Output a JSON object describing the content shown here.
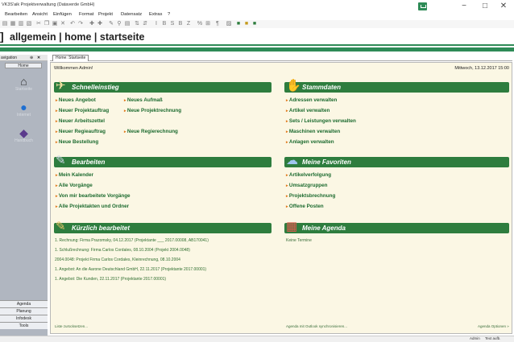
{
  "window": {
    "title": "VK3S'aik Projektverwaltung (Dataverde GmbH)",
    "controls": {
      "minimize": "−",
      "maximize": "□",
      "close": "✕"
    }
  },
  "menu": [
    "Bearbeiten",
    "Ansicht",
    "Einfügen",
    "Format",
    "Projekt",
    "Datensatz",
    "Extras",
    "?"
  ],
  "header": {
    "title": "allgemein | home | startseite"
  },
  "navigation": {
    "title": "avigation",
    "pin": "⊕",
    "close": "✕",
    "home_tab": "Home",
    "items": [
      {
        "label": "Startseite",
        "icon": "house-icon",
        "glyph": "⌂"
      },
      {
        "label": "Internet",
        "icon": "globe-icon",
        "glyph": "●"
      },
      {
        "label": "Handbuch",
        "icon": "book-icon",
        "glyph": "◆"
      }
    ],
    "bottom_tabs": [
      "Agenda",
      "Planung",
      "Infodesk",
      "Tools"
    ]
  },
  "tabs": [
    {
      "label": "Home: Startseite"
    }
  ],
  "content": {
    "welcome": "Willkommen Admin!",
    "datetime": "Mittwoch, 13.12.2017 15:00",
    "schnelleinstieg": {
      "title": "Schnelleinstieg",
      "col1": [
        "Neues Angebot",
        "Neuer Projektauftrag",
        "Neuer Arbeitszettel",
        "Neuer Regieauftrag",
        "Neue Bestellung"
      ],
      "col2": [
        "Neues Aufmaß",
        "Neue Projektrechnung",
        "Neue Regierechnung"
      ]
    },
    "stammdaten": {
      "title": "Stammdaten",
      "items": [
        "Adressen verwalten",
        "Artikel verwalten",
        "Sets / Leistungen verwalten",
        "Maschinen verwalten",
        "Anlagen verwalten"
      ]
    },
    "bearbeiten": {
      "title": "Bearbeiten",
      "items": [
        "Mein Kalender",
        "Alle Vorgänge",
        "Von mir bearbeitete Vorgänge",
        "Alle Projektakten und Ordner"
      ]
    },
    "favoriten": {
      "title": "Meine Favoriten",
      "items": [
        "Artikelverfolgung",
        "Umsatzgruppen",
        "Projektsbrechnung",
        "Offene Posten"
      ]
    },
    "kuerzlich": {
      "title": "Kürzlich bearbeitet",
      "items": [
        "1. Rechnung: Firma Prazomsky, 04.12.2017 (Projektante ___ 2017.00008, AB170041)",
        "1. Schlußrechnung: Firma Carlos Cordales, 08.10.2004 (Projekt 2004.0048)",
        "2004.0048: Projekt Firma Carlos Cordales, Kleinrechnung, 08.10.2004",
        "1. Angebot: An die Aarone Deutschland GmbH, 22.11.2017 (Projektante 2017.00001)",
        "1. Angebot: Die Kunden, 22.11.2017 (Projektante 2017.00001)"
      ],
      "footer": "Liste zurücksetzen..."
    },
    "agenda": {
      "title": "Meine Agenda",
      "empty": "Keine Termine",
      "footer_left": "Agenda mit Outlook synchronisieren...",
      "footer_right": "Agenda Optionen »"
    }
  },
  "status": {
    "user": "Admin",
    "extra": "Text aufb."
  },
  "colors": {
    "accent": "#2e8b57",
    "panel_header": "#2e7d3e",
    "content_bg": "#fbf7e4",
    "link": "#1b6a2e",
    "arrow": "#e07a1e",
    "nav_bg": "#b0b6c0"
  }
}
